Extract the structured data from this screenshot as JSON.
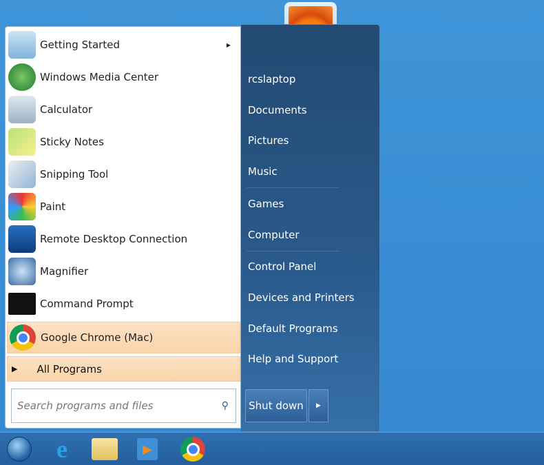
{
  "user": {
    "name": "rcslaptop"
  },
  "programs": [
    {
      "label": "Getting Started",
      "icon": "getting-started-icon",
      "has_submenu": true
    },
    {
      "label": "Windows Media Center",
      "icon": "media-center-icon"
    },
    {
      "label": "Calculator",
      "icon": "calculator-icon"
    },
    {
      "label": "Sticky Notes",
      "icon": "sticky-notes-icon"
    },
    {
      "label": "Snipping Tool",
      "icon": "snipping-tool-icon"
    },
    {
      "label": "Paint",
      "icon": "paint-icon"
    },
    {
      "label": "Remote Desktop Connection",
      "icon": "remote-desktop-icon"
    },
    {
      "label": "Magnifier",
      "icon": "magnifier-icon"
    },
    {
      "label": "Command Prompt",
      "icon": "command-prompt-icon"
    },
    {
      "label": "Google Chrome (Mac)",
      "icon": "chrome-icon",
      "highlighted": true
    }
  ],
  "all_programs": "All Programs",
  "search": {
    "placeholder": "Search programs and files"
  },
  "right_items": [
    "Documents",
    "Pictures",
    "Music",
    "Games",
    "Computer",
    "Control Panel",
    "Devices and Printers",
    "Default Programs",
    "Help and Support"
  ],
  "shutdown": {
    "label": "Shut down"
  },
  "taskbar": [
    "start-orb",
    "internet-explorer",
    "windows-explorer",
    "media-player",
    "google-chrome"
  ]
}
